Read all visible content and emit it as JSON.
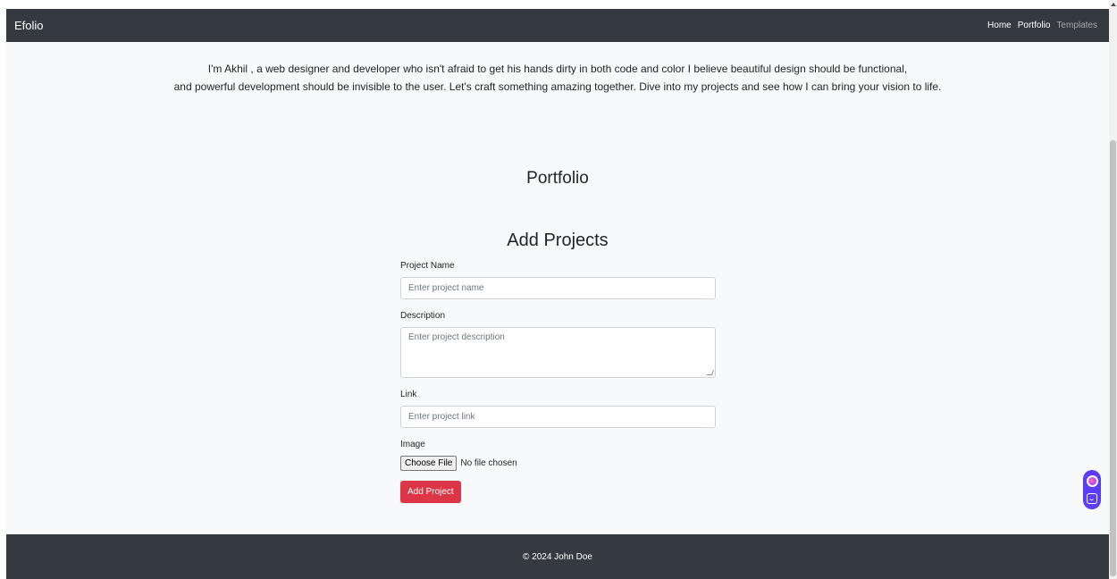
{
  "navbar": {
    "brand": "Efolio",
    "links": [
      {
        "label": "Home"
      },
      {
        "label": "Portfolio"
      },
      {
        "label": "Templates"
      }
    ]
  },
  "intro": {
    "line1": "I'm Akhil , a web designer and developer who isn't afraid to get his hands dirty in both code and color I believe beautiful design should be functional,",
    "line2": "and powerful development should be invisible to the user. Let's craft something amazing together. Dive into my projects and see how I can bring your vision to life."
  },
  "portfolio": {
    "heading": "Portfolio"
  },
  "form": {
    "title": "Add Projects",
    "project_name": {
      "label": "Project Name",
      "placeholder": "Enter project name"
    },
    "description": {
      "label": "Description",
      "placeholder": "Enter project description"
    },
    "link": {
      "label": "Link",
      "placeholder": "Enter project link"
    },
    "image": {
      "label": "Image",
      "button": "Choose File",
      "status": "No file chosen"
    },
    "submit": "Add Project"
  },
  "footer": {
    "text": "© 2024 John Doe"
  },
  "colors": {
    "navbar_bg": "#343a40",
    "page_bg": "#f8f9fa",
    "submit_bg": "#dc3545",
    "widget_bg": "#5b3df5"
  }
}
